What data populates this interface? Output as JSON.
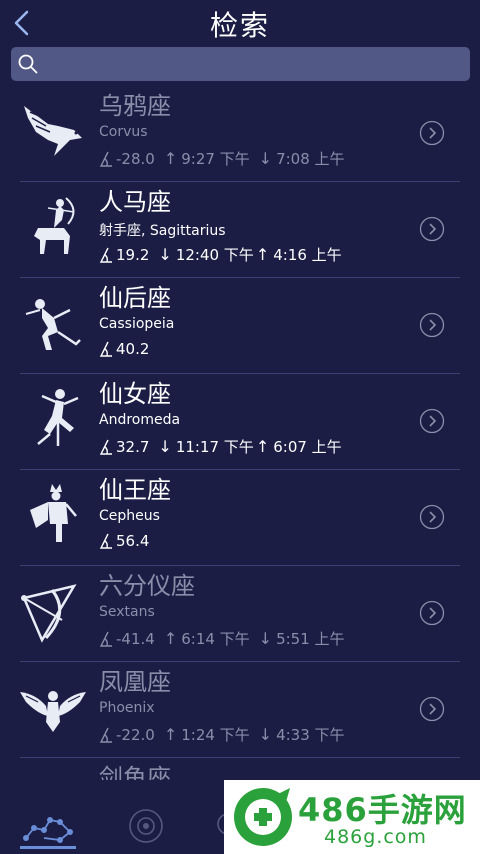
{
  "header": {
    "title": "检索",
    "back_icon": "chevron-left-icon"
  },
  "search": {
    "value": "",
    "placeholder": "",
    "icon": "search-icon"
  },
  "constellations": [
    {
      "name": "乌鸦座",
      "subtitle": "Corvus",
      "altitude": "-28.0",
      "rise_arrow": "↑",
      "rise": "9:27 下午",
      "set_arrow": "↓",
      "set": "7:08 上午",
      "dim": true,
      "icon": "crow-icon"
    },
    {
      "name": "人马座",
      "subtitle": "射手座, Sagittarius",
      "altitude": "19.2",
      "rise_arrow": "↓",
      "rise": "12:40 下午",
      "set_arrow": "↑",
      "set": "4:16 上午",
      "dim": false,
      "icon": "centaur-archer-icon"
    },
    {
      "name": "仙后座",
      "subtitle": "Cassiopeia",
      "altitude": "40.2",
      "rise_arrow": "",
      "rise": "",
      "set_arrow": "",
      "set": "",
      "dim": false,
      "icon": "queen-icon"
    },
    {
      "name": "仙女座",
      "subtitle": "Andromeda",
      "altitude": "32.7",
      "rise_arrow": "↓",
      "rise": "11:17 下午",
      "set_arrow": "↑",
      "set": "6:07 上午",
      "dim": false,
      "icon": "maiden-icon"
    },
    {
      "name": "仙王座",
      "subtitle": "Cepheus",
      "altitude": "56.4",
      "rise_arrow": "",
      "rise": "",
      "set_arrow": "",
      "set": "",
      "dim": false,
      "icon": "king-icon"
    },
    {
      "name": "六分仪座",
      "subtitle": "Sextans",
      "altitude": "-41.4",
      "rise_arrow": "↑",
      "rise": "6:14 下午",
      "set_arrow": "↓",
      "set": "5:51 上午",
      "dim": true,
      "icon": "sextant-icon"
    },
    {
      "name": "凤凰座",
      "subtitle": "Phoenix",
      "altitude": "-22.0",
      "rise_arrow": "↑",
      "rise": "1:24 下午",
      "set_arrow": "↓",
      "set": "4:33 下午",
      "dim": true,
      "icon": "phoenix-icon"
    },
    {
      "name": "剑鱼座",
      "subtitle": "",
      "altitude": "",
      "rise_arrow": "",
      "rise": "",
      "set_arrow": "",
      "set": "",
      "dim": true,
      "icon": "swordfish-icon"
    }
  ],
  "tabbar": {
    "tabs": [
      "constellation-tab-icon",
      "planet-tab-icon",
      "more-tab-icon"
    ]
  },
  "watermark": {
    "brand": "486手游网",
    "url": "486g.com"
  },
  "colors": {
    "background": "#1b1d45",
    "search_bg": "#525886",
    "divider": "#3d4170",
    "dim_text": "#8b8ea8",
    "watermark_green": "#2aa13a"
  }
}
